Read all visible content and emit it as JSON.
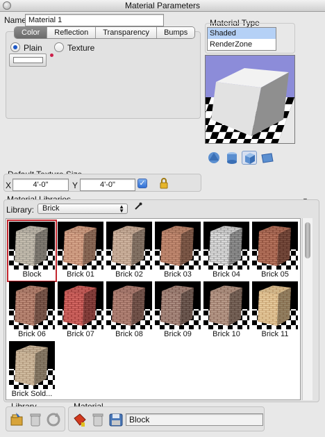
{
  "window": {
    "title": "Material Parameters"
  },
  "name_field": {
    "label": "Name",
    "value": "Material 1"
  },
  "tabs": [
    "Color",
    "Reflection",
    "Transparency",
    "Bumps"
  ],
  "color_options": {
    "plain_label": "Plain",
    "texture_label": "Texture",
    "selected": "Plain",
    "swatch_color": "#ffffff"
  },
  "material_type": {
    "label": "Material Type",
    "options": [
      "Shaded",
      "RenderZone"
    ],
    "selected": "Shaded"
  },
  "preview": {
    "shape_buttons": [
      "sphere-shape-icon",
      "cylinder-shape-icon",
      "cube-shape-icon",
      "plane-shape-icon"
    ],
    "active_shape": "cube"
  },
  "texture_size": {
    "label": "Default Texture Size",
    "x_label": "X",
    "x_value": "4'-0\"",
    "y_label": "Y",
    "y_value": "4'-0\"",
    "linked": true
  },
  "libraries": {
    "label": "Material Libraries",
    "library_label": "Library:",
    "library_value": "Brick",
    "selected": "Block",
    "items": [
      "Block",
      "Brick 01",
      "Brick 02",
      "Brick 03",
      "Brick 04",
      "Brick 05",
      "Brick 06",
      "Brick 07",
      "Brick 08",
      "Brick 09",
      "Brick 10",
      "Brick 11",
      "Brick Sold..."
    ]
  },
  "bottom": {
    "library_label": "Library",
    "material_label": "Material",
    "material_value": "Block"
  },
  "colors": {
    "selection_border": "#c3262e",
    "list_selection": "#b5d1f6",
    "preview_sky": "#8c8cd9"
  }
}
